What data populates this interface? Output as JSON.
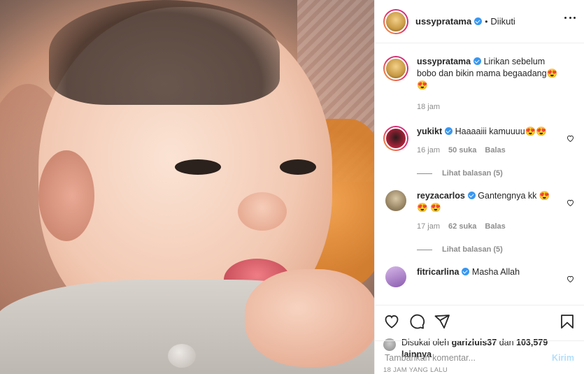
{
  "header": {
    "username": "ussypratama",
    "separator": "•",
    "follow_status": "Diikuti"
  },
  "caption": {
    "username": "ussypratama",
    "text": "Lirikan sebelum bobo dan bikin mama begaadang😍😍",
    "time": "18 jam"
  },
  "comments": [
    {
      "username": "yukikt",
      "text": "Haaaaiii kamuuuu😍😍",
      "time": "16 jam",
      "likes": "50 suka",
      "reply": "Balas",
      "view_replies": "Lihat balasan (5)"
    },
    {
      "username": "reyzacarlos",
      "text": "Gantengnya kk 😍😍 😍",
      "time": "17 jam",
      "likes": "62 suka",
      "reply": "Balas",
      "view_replies": "Lihat balasan (5)"
    },
    {
      "username": "fitricarlina",
      "text": "Masha Allah"
    }
  ],
  "likes": {
    "prefix": "Disukai oleh",
    "user": "garizluis37",
    "and": "dan",
    "count": "103,579 lainnya"
  },
  "time_ago": "18 JAM YANG LALU",
  "add_comment": {
    "placeholder": "Tambahkan komentar...",
    "post_label": "Kirim"
  },
  "icons": {
    "verified": "verified-badge-icon",
    "more": "more-options-icon",
    "heart": "heart-icon",
    "comment": "comment-icon",
    "share": "share-icon",
    "save": "bookmark-icon"
  },
  "colors": {
    "verified": "#3897f0",
    "muted": "#8e8e8e",
    "post_button": "#b2dffc"
  }
}
